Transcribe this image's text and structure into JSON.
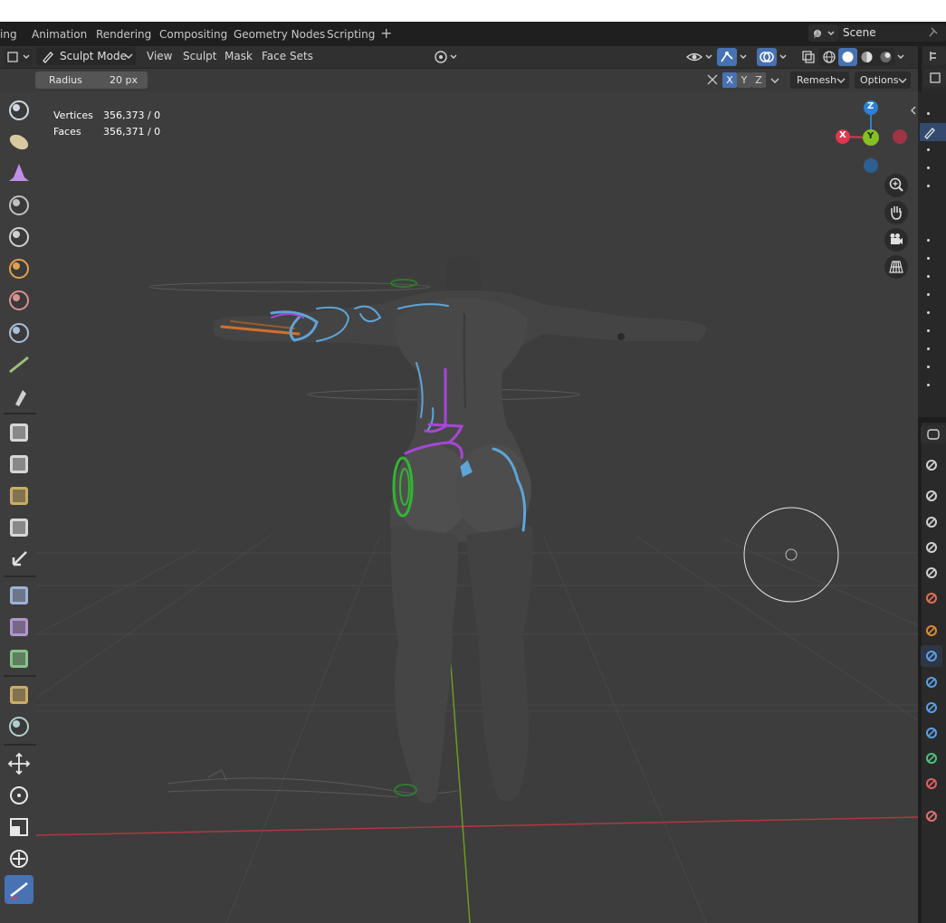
{
  "topbar": {
    "workspace_tabs": [
      "ing",
      "Animation",
      "Rendering",
      "Compositing",
      "Geometry Nodes",
      "Scripting"
    ],
    "add_tab": "+",
    "scene_label": "Scene"
  },
  "header": {
    "mode": "Sculpt Mode",
    "menus": [
      "View",
      "Sculpt",
      "Mask",
      "Face Sets"
    ]
  },
  "tool_settings": {
    "radius_label": "Radius",
    "radius_value": "20 px",
    "symmetry_axes": [
      "X",
      "Y",
      "Z"
    ],
    "remesh_label": "Remesh",
    "options_label": "Options"
  },
  "overlay_stats": {
    "vertices_label": "Vertices",
    "vertices_value": "356,373 / 0",
    "faces_label": "Faces",
    "faces_value": "356,371 / 0"
  },
  "gizmo": {
    "axis_x": "X",
    "axis_y": "Y",
    "axis_z": "Z",
    "colors": {
      "x": "#e0364e",
      "y": "#85c024",
      "z": "#2d80d2",
      "x_neg": "#a03444",
      "z_neg": "#2d5f91"
    }
  },
  "colors": {
    "accent": "#4772b3",
    "viewport_bg": "#3d3d3d",
    "header_bg": "#303030",
    "mask_purple": "#a647d6",
    "stroke_blue": "#5fa4d6",
    "stroke_green": "#33b533"
  },
  "toolbar_icons": [
    "draw-brush",
    "clay-brush",
    "clay-strips",
    "layer-brush",
    "inflate-brush",
    "blob-brush",
    "crease-brush",
    "smooth-brush",
    "flatten-brush",
    "fill-brush",
    "scrape-brush",
    "multiplane-scrape",
    "pinch-brush",
    "grab-brush",
    "elastic-deform",
    "snake-hook",
    "thumb-brush",
    "pose-brush",
    "nudge-brush",
    "rotate-brush",
    "slide-relax",
    "boundary-brush",
    "cloth-brush",
    "simplify-brush",
    "mask-brush",
    "draw-face-sets",
    "multires-displacement",
    "box-mask",
    "box-hide",
    "box-face-set",
    "box-trim",
    "line-project",
    "mesh-filter",
    "cloth-filter",
    "color-filter",
    "edit-face-set",
    "mask-by-color",
    "move",
    "rotate",
    "scale",
    "transform",
    "annotate"
  ],
  "properties_tabs": [
    "tool",
    "render",
    "output",
    "view-layer",
    "scene",
    "world",
    "object",
    "modifiers",
    "particles",
    "physics",
    "constraints",
    "data",
    "material",
    "texture"
  ]
}
